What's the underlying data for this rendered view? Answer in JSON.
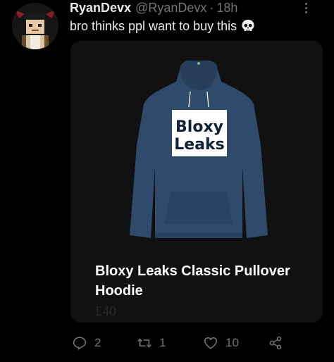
{
  "tweet": {
    "author_name": "RyanDevx",
    "author_handle": "@RyanDevx",
    "separator": "·",
    "timestamp": "18h",
    "text": "bro thinks ppl want to buy this",
    "emoji": "skull"
  },
  "card": {
    "image_logo_text": [
      "Bloxy",
      "Leaks"
    ],
    "product_title": "Bloxy Leaks Classic Pullover Hoodie",
    "price": "£40",
    "hoodie_color": "#2f4a6b"
  },
  "actions": {
    "reply_count": "2",
    "retweet_count": "1",
    "like_count": "10"
  },
  "colors": {
    "background": "#000000",
    "text_primary": "#e7e9ea",
    "text_secondary": "#71767b",
    "card_bg": "#111111"
  }
}
